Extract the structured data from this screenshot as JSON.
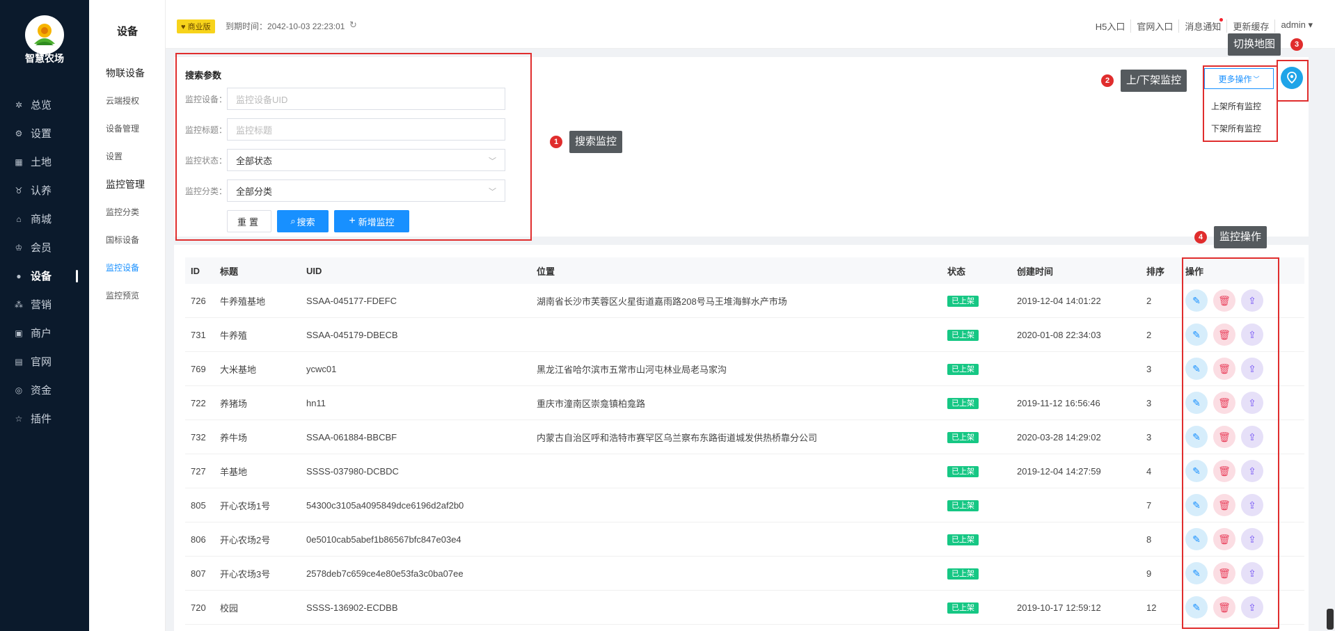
{
  "app": {
    "name": "智慧农场"
  },
  "sidebar": {
    "items": [
      {
        "label": "总览",
        "icon": "dashboard-icon",
        "glyph": "✲"
      },
      {
        "label": "设置",
        "icon": "gear-icon",
        "glyph": "⚙"
      },
      {
        "label": "土地",
        "icon": "grid-icon",
        "glyph": "▦"
      },
      {
        "label": "认养",
        "icon": "cow-icon",
        "glyph": "♉"
      },
      {
        "label": "商城",
        "icon": "shop-icon",
        "glyph": "⌂"
      },
      {
        "label": "会员",
        "icon": "member-icon",
        "glyph": "♔"
      },
      {
        "label": "设备",
        "icon": "location-pin-icon",
        "glyph": "●"
      },
      {
        "label": "营销",
        "icon": "marketing-icon",
        "glyph": "⁂"
      },
      {
        "label": "商户",
        "icon": "merchant-icon",
        "glyph": "▣"
      },
      {
        "label": "官网",
        "icon": "website-icon",
        "glyph": "▤"
      },
      {
        "label": "资金",
        "icon": "money-icon",
        "glyph": "◎"
      },
      {
        "label": "插件",
        "icon": "star-icon",
        "glyph": "☆"
      }
    ],
    "active_index": 6
  },
  "subnav": {
    "title": "设备",
    "groups": [
      {
        "label": "物联设备",
        "items": [
          "云端授权",
          "设备管理",
          "设置"
        ]
      },
      {
        "label": "监控管理",
        "items": [
          "监控分类",
          "国标设备",
          "监控设备",
          "监控预览"
        ]
      }
    ],
    "active_item": "监控设备"
  },
  "topbar": {
    "badge": "♥ 商业版",
    "expire_text": "到期时间：2042-10-03 22:23:01",
    "links": [
      "H5入口",
      "官网入口",
      "消息通知",
      "更新缓存",
      "admin ▾"
    ]
  },
  "search": {
    "title": "搜索参数",
    "fields": [
      {
        "label": "监控设备：",
        "placeholder": "监控设备UID",
        "value": ""
      },
      {
        "label": "监控标题：",
        "placeholder": "监控标题",
        "value": ""
      },
      {
        "label": "监控状态：",
        "placeholder": "",
        "value": "全部状态"
      },
      {
        "label": "监控分类：",
        "placeholder": "",
        "value": "全部分类"
      }
    ],
    "reset_label": "重置",
    "search_label": "搜索",
    "add_label": "新增监控"
  },
  "actions": {
    "more_label": "更多操作",
    "dropdown": [
      "上架所有监控",
      "下架所有监控"
    ]
  },
  "annotations": [
    {
      "num": "1",
      "text": "搜索监控"
    },
    {
      "num": "2",
      "text": "上/下架监控"
    },
    {
      "num": "3",
      "text": "切换地图"
    },
    {
      "num": "4",
      "text": "监控操作"
    }
  ],
  "table": {
    "columns": [
      "ID",
      "标题",
      "UID",
      "位置",
      "状态",
      "创建时间",
      "排序",
      "操作"
    ],
    "rows": [
      {
        "id": "726",
        "title": "牛养殖基地",
        "uid": "SSAA-045177-FDEFC",
        "loc": "湖南省长沙市芙蓉区火星街道嘉雨路208号马王堆海鲜水产市场",
        "status": "已上架",
        "time": "2019-12-04 14:01:22",
        "sort": "2"
      },
      {
        "id": "731",
        "title": "牛养殖",
        "uid": "SSAA-045179-DBECB",
        "loc": "",
        "status": "已上架",
        "time": "2020-01-08 22:34:03",
        "sort": "2"
      },
      {
        "id": "769",
        "title": "大米基地",
        "uid": "ycwc01",
        "loc": "黑龙江省哈尔滨市五常市山河屯林业局老马家沟",
        "status": "已上架",
        "time": "",
        "sort": "3"
      },
      {
        "id": "722",
        "title": "养猪场",
        "uid": "hn11",
        "loc": "重庆市潼南区崇龛镇柏龛路",
        "status": "已上架",
        "time": "2019-11-12 16:56:46",
        "sort": "3"
      },
      {
        "id": "732",
        "title": "养牛场",
        "uid": "SSAA-061884-BBCBF",
        "loc": "内蒙古自治区呼和浩特市赛罕区乌兰察布东路街道城发供热桥靠分公司",
        "status": "已上架",
        "time": "2020-03-28 14:29:02",
        "sort": "3"
      },
      {
        "id": "727",
        "title": "羊基地",
        "uid": "SSSS-037980-DCBDC",
        "loc": "",
        "status": "已上架",
        "time": "2019-12-04 14:27:59",
        "sort": "4"
      },
      {
        "id": "805",
        "title": "开心农场1号",
        "uid": "54300c3105a4095849dce6196d2af2b0",
        "loc": "",
        "status": "已上架",
        "time": "",
        "sort": "7"
      },
      {
        "id": "806",
        "title": "开心农场2号",
        "uid": "0e5010cab5abef1b86567bfc847e03e4",
        "loc": "",
        "status": "已上架",
        "time": "",
        "sort": "8"
      },
      {
        "id": "807",
        "title": "开心农场3号",
        "uid": "2578deb7c659ce4e80e53fa3c0ba07ee",
        "loc": "",
        "status": "已上架",
        "time": "",
        "sort": "9"
      },
      {
        "id": "720",
        "title": "校园",
        "uid": "SSSS-136902-ECDBB",
        "loc": "",
        "status": "已上架",
        "time": "2019-10-17 12:59:12",
        "sort": "12"
      }
    ]
  },
  "colors": {
    "primary": "#1890ff",
    "sidebar_bg": "#0b1a2c",
    "status_green": "#16c784",
    "annotation_red": "#e02d2d"
  }
}
